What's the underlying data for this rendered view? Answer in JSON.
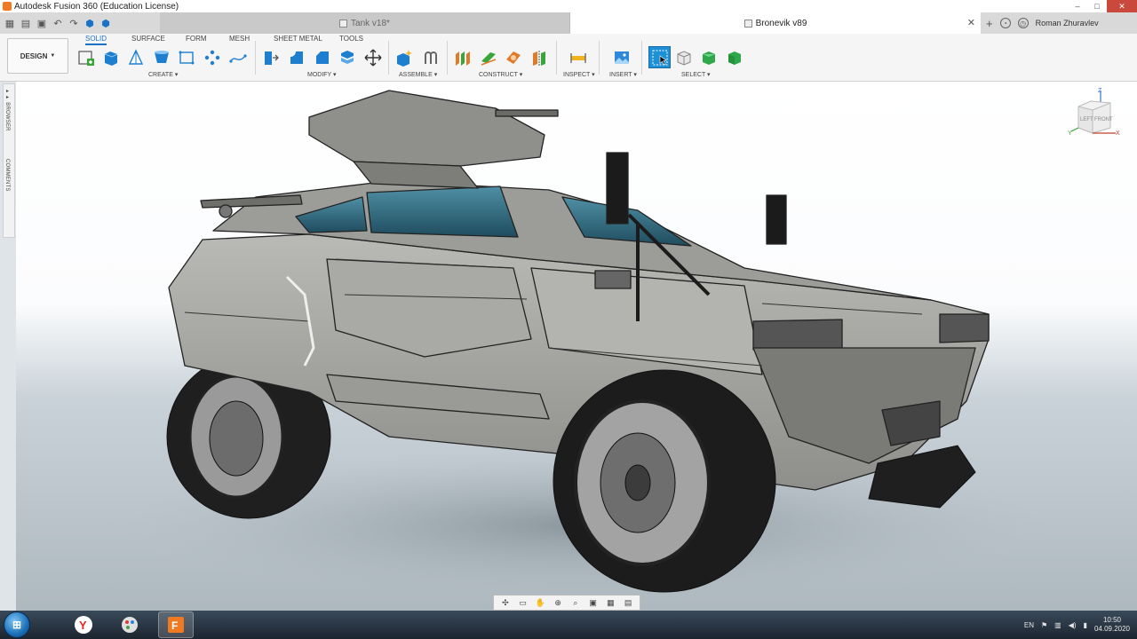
{
  "window": {
    "title": "Autodesk Fusion 360 (Education License)",
    "controls": {
      "minimize": "–",
      "maximize": "□",
      "close": "✕"
    }
  },
  "tabs": [
    {
      "label": "Tank v18*",
      "active": false
    },
    {
      "label": "Bronevik v89",
      "active": true
    }
  ],
  "user": {
    "name": "Roman Zhuravlev"
  },
  "workspace": {
    "label": "DESIGN"
  },
  "ribbon_tabs": [
    "SOLID",
    "SURFACE",
    "FORM",
    "MESH",
    "SHEET METAL",
    "TOOLS"
  ],
  "groups": {
    "create": "CREATE",
    "modify": "MODIFY",
    "assemble": "ASSEMBLE",
    "construct": "CONSTRUCT",
    "inspect": "INSPECT",
    "insert": "INSERT",
    "select": "SELECT"
  },
  "side_panels": {
    "browser": "BROWSER",
    "comments": "COMMENTS"
  },
  "viewcube": {
    "left": "LEFT",
    "front": "FRONT",
    "z": "Z",
    "x": "X",
    "y": "Y"
  },
  "taskbar": {
    "language": "EN",
    "time": "10:50",
    "date": "04.09.2020"
  },
  "colors": {
    "accent": "#1a73c8",
    "fusion_orange": "#f07a22",
    "select_blue": "#1e90d6"
  }
}
